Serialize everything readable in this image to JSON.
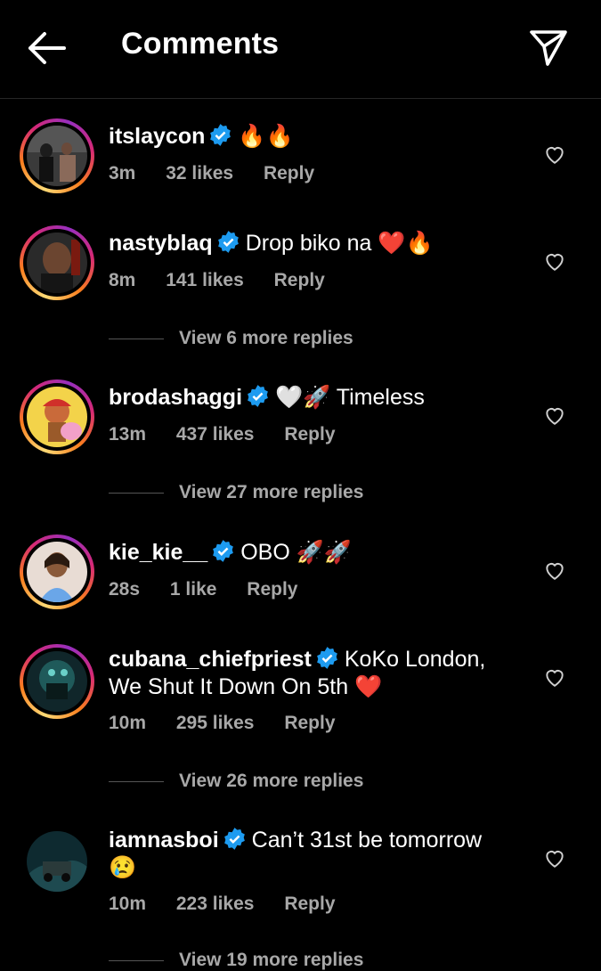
{
  "header": {
    "title": "Comments"
  },
  "comments": [
    {
      "username": "itslaycon",
      "text": "🔥🔥",
      "time": "3m",
      "likes": "32 likes",
      "reply": "Reply"
    },
    {
      "username": "nastyblaq",
      "text": "Drop biko na ❤️🔥",
      "time": "8m",
      "likes": "141 likes",
      "reply": "Reply",
      "view_replies": "View 6 more replies"
    },
    {
      "username": "brodashaggi",
      "text": "🤍🚀 Timeless",
      "time": "13m",
      "likes": "437 likes",
      "reply": "Reply",
      "view_replies": "View 27 more replies"
    },
    {
      "username": "kie_kie__",
      "text": "OBO 🚀🚀",
      "time": "28s",
      "likes": "1 like",
      "reply": "Reply"
    },
    {
      "username": "cubana_chiefpriest",
      "text": "KoKo London, We Shut It Down On 5th ❤️",
      "time": "10m",
      "likes": "295 likes",
      "reply": "Reply",
      "view_replies": "View 26 more replies"
    },
    {
      "username": "iamnasboi",
      "text": "Can’t 31st be tomorrow 😢",
      "time": "10m",
      "likes": "223 likes",
      "reply": "Reply",
      "view_replies": "View 19 more replies"
    }
  ],
  "colors": {
    "background": "#000000",
    "verified": "#1d9bf0",
    "muted_text": "#a8a8a8"
  }
}
